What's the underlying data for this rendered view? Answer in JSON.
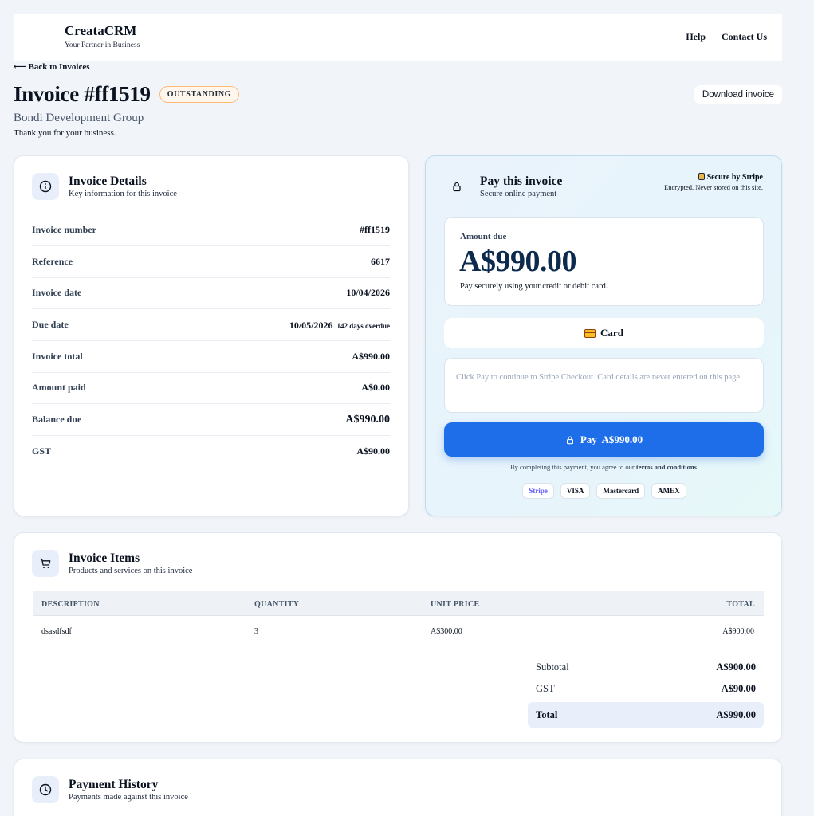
{
  "header": {
    "brand_name": "CreataCRM",
    "brand_tagline": "Your Partner in Business",
    "nav": [
      "Help",
      "Contact Us"
    ]
  },
  "back_link": "⟵ Back to Invoices",
  "invoice": {
    "title": "Invoice #ff1519",
    "status": "OUTSTANDING",
    "download_label": "Download invoice",
    "company": "Bondi Development Group",
    "thanks": "Thank you for your business."
  },
  "details": {
    "title": "Invoice Details",
    "subtitle": "Key information for this invoice",
    "rows": [
      {
        "label": "Invoice number",
        "value": "#ff1519"
      },
      {
        "label": "Reference",
        "value": "6617"
      },
      {
        "label": "Invoice date",
        "value": "10/04/2026"
      },
      {
        "label": "Due date",
        "value": "10/05/2026",
        "note": "142 days overdue"
      },
      {
        "label": "Invoice total",
        "value": "A$990.00"
      },
      {
        "label": "Amount paid",
        "value": "A$0.00"
      },
      {
        "label": "Balance due",
        "value": "A$990.00"
      },
      {
        "label": "GST",
        "value": "A$90.00"
      }
    ]
  },
  "pay": {
    "title": "Pay this invoice",
    "subtitle": "Secure online payment",
    "secure_title": "Secure by Stripe",
    "secure_sub": "Encrypted. Never stored on this site.",
    "amount_label": "Amount due",
    "amount_value": "A$990.00",
    "amount_note": "Pay securely using your credit or debit card.",
    "method_label": "Card",
    "info_text": "Click Pay to continue to Stripe Checkout. Card details are never entered on this page.",
    "button_label": "Pay  A$990.00",
    "terms_prefix": "By completing this payment, you agree to our ",
    "terms_link": "terms and conditions",
    "terms_suffix": ".",
    "brands": [
      "Stripe",
      "VISA",
      "Mastercard",
      "AMEX"
    ]
  },
  "items": {
    "title": "Invoice Items",
    "subtitle": "Products and services on this invoice",
    "columns": [
      "DESCRIPTION",
      "QUANTITY",
      "UNIT PRICE",
      "TOTAL"
    ],
    "rows": [
      {
        "description": "dsasdfsdf",
        "quantity": "3",
        "unit_price": "A$300.00",
        "total": "A$900.00"
      }
    ],
    "subtotal_label": "Subtotal",
    "subtotal_value": "A$900.00",
    "gst_label": "GST",
    "gst_value": "A$90.00",
    "total_label": "Total",
    "total_value": "A$990.00"
  },
  "history": {
    "title": "Payment History",
    "subtitle": "Payments made against this invoice"
  }
}
